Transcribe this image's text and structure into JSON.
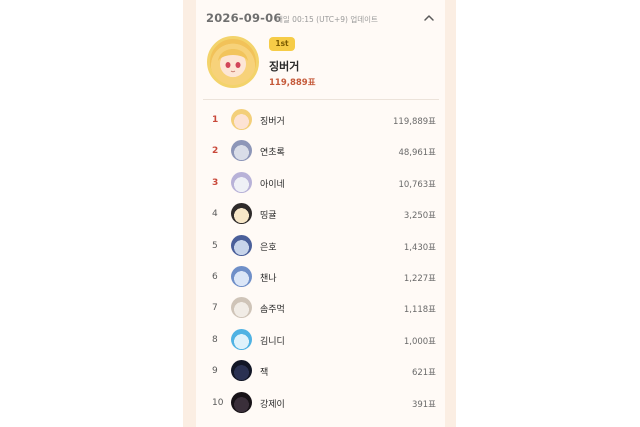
{
  "header": {
    "date": "2026-09-06",
    "update_text": "매일 00:15 (UTC+9) 업데이트",
    "collapse_icon": "chevron-up-icon"
  },
  "top": {
    "badge": "1st",
    "name": "징버거",
    "votes": "119,889표"
  },
  "colors": {
    "panel_bg": "#fbeee3",
    "card_bg": "#fffaf6",
    "top_rank": "#c9483a",
    "badge": "#f6cc47"
  },
  "ranking": [
    {
      "rank": "1",
      "name": "징버거",
      "votes": "119,889표",
      "avatar": [
        "#fde3d4",
        "#f3cf7a"
      ]
    },
    {
      "rank": "2",
      "name": "연초록",
      "votes": "48,961표",
      "avatar": [
        "#d9dde8",
        "#8d96b8"
      ]
    },
    {
      "rank": "3",
      "name": "아이네",
      "votes": "10,763표",
      "avatar": [
        "#eef0f6",
        "#b8b2d8"
      ]
    },
    {
      "rank": "4",
      "name": "띵귤",
      "votes": "3,250표",
      "avatar": [
        "#f6e6c8",
        "#2e2a2a"
      ]
    },
    {
      "rank": "5",
      "name": "은호",
      "votes": "1,430표",
      "avatar": [
        "#c7d4ea",
        "#4a5f9a"
      ]
    },
    {
      "rank": "6",
      "name": "챈나",
      "votes": "1,227표",
      "avatar": [
        "#dbe6f7",
        "#6f8fc8"
      ]
    },
    {
      "rank": "7",
      "name": "솜주먹",
      "votes": "1,118표",
      "avatar": [
        "#f1ece6",
        "#cfc4b8"
      ]
    },
    {
      "rank": "8",
      "name": "김니디",
      "votes": "1,000표",
      "avatar": [
        "#dff2fb",
        "#4fb2e3"
      ]
    },
    {
      "rank": "9",
      "name": "잭",
      "votes": "621표",
      "avatar": [
        "#2a3152",
        "#121626"
      ]
    },
    {
      "rank": "10",
      "name": "강제이",
      "votes": "391표",
      "avatar": [
        "#3a2f3a",
        "#171217"
      ]
    }
  ]
}
